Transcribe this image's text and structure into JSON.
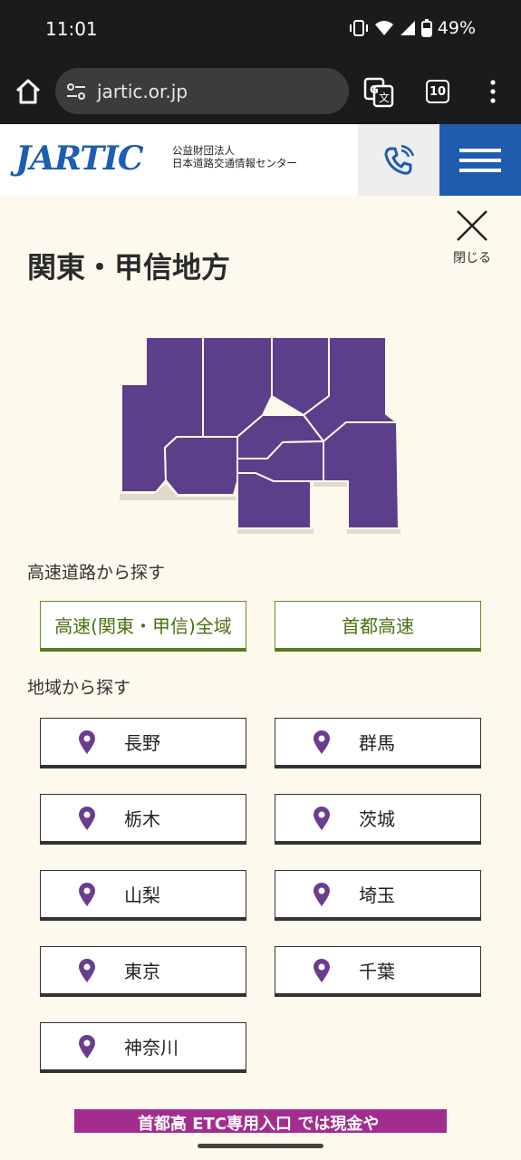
{
  "status_bar": {
    "time": "11:01",
    "battery": "49%"
  },
  "browser": {
    "url": "jartic.or.jp",
    "tab_count": "10"
  },
  "header": {
    "logo": "JARTIC",
    "org_line1": "公益財団法人",
    "org_line2": "日本道路交通情報センター"
  },
  "close_label": "閉じる",
  "page_title": "関東・甲信地方",
  "colors": {
    "region": "#5c3f8a",
    "accent_green": "#6b8e23",
    "brand_blue": "#1f5cae"
  },
  "highway_section": {
    "label": "高速道路から探す",
    "buttons": [
      "高速(関東・甲信)全域",
      "首都高速"
    ]
  },
  "region_section": {
    "label": "地域から探す",
    "regions": [
      "長野",
      "群馬",
      "栃木",
      "茨城",
      "山梨",
      "埼玉",
      "東京",
      "千葉",
      "神奈川"
    ]
  },
  "banner": {
    "text": "首都高 ETC専用入口 では現金や"
  }
}
